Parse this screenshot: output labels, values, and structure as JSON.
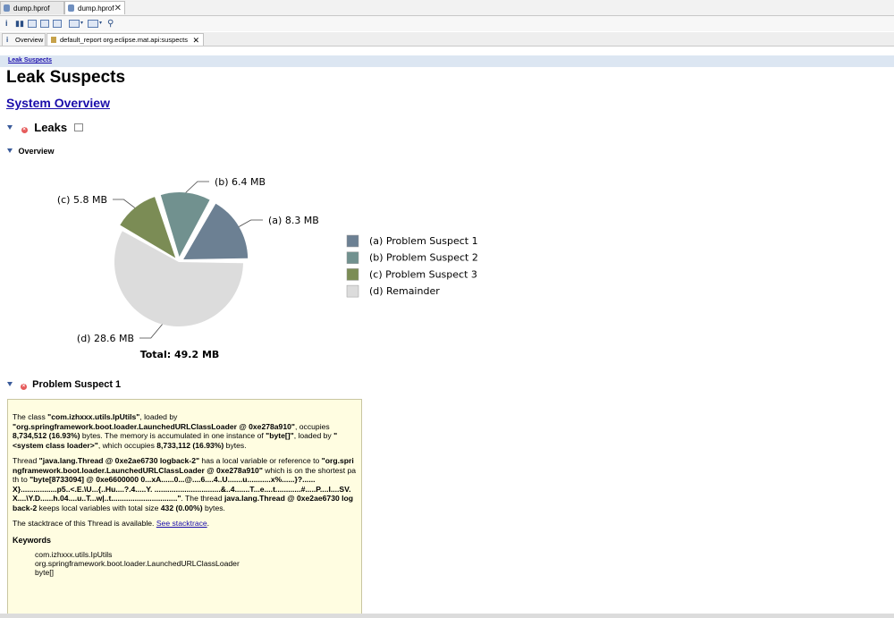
{
  "tabs": [
    {
      "label": "dump.hprof",
      "active": false
    },
    {
      "label": "dump.hprof",
      "active": true
    }
  ],
  "editor_tabs": [
    {
      "label": "Overview"
    },
    {
      "label": "default_report org.eclipse.mat.api:suspects"
    }
  ],
  "breadcrumb": "Leak Suspects",
  "page_title": "Leak Suspects",
  "system_overview_link": "System Overview",
  "sections": {
    "leaks": "Leaks",
    "overview": "Overview",
    "problem_suspect_1": "Problem Suspect 1"
  },
  "chart_data": {
    "type": "pie",
    "total_label": "Total: 49.2 MB",
    "slices": [
      {
        "label": "(a)",
        "name": "Problem Suspect 1",
        "value_label": "8.3 MB",
        "value": 8.3,
        "color": "#6c8093"
      },
      {
        "label": "(b)",
        "name": "Problem Suspect 2",
        "value_label": "6.4 MB",
        "value": 6.4,
        "color": "#71918f"
      },
      {
        "label": "(c)",
        "name": "Problem Suspect 3",
        "value_label": "5.8 MB",
        "value": 5.8,
        "color": "#7b8c55"
      },
      {
        "label": "(d)",
        "name": "Remainder",
        "value_label": "28.6 MB",
        "value": 28.6,
        "color": "#dcdcdc"
      }
    ]
  },
  "suspect1": {
    "p1": [
      "The class ",
      "\"com.izhxxx.utils.IpUtils\"",
      ", loaded by ",
      "\"org.springframework.boot.loader.LaunchedURLClassLoader @ 0xe278a910\"",
      ", occupies ",
      "8,734,512 (16.93%)",
      " bytes. The memory is accumulated in one instance of ",
      "\"byte[]\"",
      ", loaded by ",
      "\"<system class loader>\"",
      ", which occupies ",
      "8,733,112 (16.93%)",
      " bytes."
    ],
    "p2": [
      "Thread ",
      "\"java.lang.Thread @ 0xe2ae6730 logback-2\"",
      " has a local variable or reference to ",
      "\"org.springframework.boot.loader.LaunchedURLClassLoader @ 0xe278a910\"",
      " which is on the shortest path to ",
      "\"byte[8733094] @ 0xe6600000 0...xA......0...@....6....4..U.......u...........x%......}?......X}.................p5..<.E.\\U...{..Hu....?.4.....Y. ...............................&..4.......T...e....t............#.....P....l....SV.X....\\Y.D......h.04....u..T...w|..t...............................\"",
      ". The thread ",
      "java.lang.Thread @ 0xe2ae6730 logback-2",
      " keeps local variables with total size ",
      "432 (0.00%)",
      " bytes."
    ],
    "p3_text": "The stacktrace of this Thread is available. ",
    "p3_link": "See stacktrace",
    "p3_end": ".",
    "keywords_title": "Keywords",
    "keywords": [
      "com.izhxxx.utils.IpUtils",
      "org.springframework.boot.loader.LaunchedURLClassLoader",
      "byte[]"
    ]
  }
}
